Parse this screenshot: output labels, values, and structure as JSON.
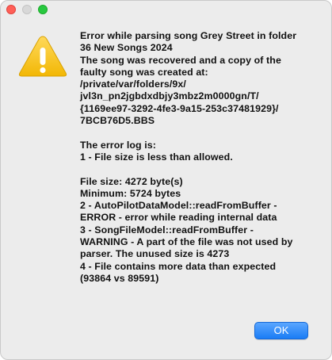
{
  "dialog": {
    "icon": "warning-icon",
    "message_lines": [
      "Error while parsing song Grey Street in folder",
      "36 New Songs 2024",
      "The song was recovered and a copy of the",
      "faulty song was created at:",
      "/private/var/folders/9x/",
      "jvl3n_pn2jgbdxdbjy3mbz2m0000gn/T/",
      "{1169ee97-3292-4fe3-9a15-253c37481929}/",
      "7BCB76D5.BBS",
      "",
      "The error log is:",
      "1 - File size is less than allowed.",
      "",
      "File size: 4272 byte(s)",
      "Minimum: 5724 bytes",
      "2 - AutoPilotDataModel::readFromBuffer -",
      "ERROR - error while reading internal data",
      "3 - SongFileModel::readFromBuffer -",
      "WARNING - A part of the file was not used by",
      "parser. The unused size is 4273",
      "4 - File contains more data than expected",
      "(93864 vs 89591)"
    ],
    "ok_label": "OK"
  },
  "colors": {
    "window_bg": "#ececec",
    "accent": "#1a7cf5",
    "warning_yellow": "#f6c437",
    "close": "#ff5f57",
    "zoom": "#28c840"
  }
}
